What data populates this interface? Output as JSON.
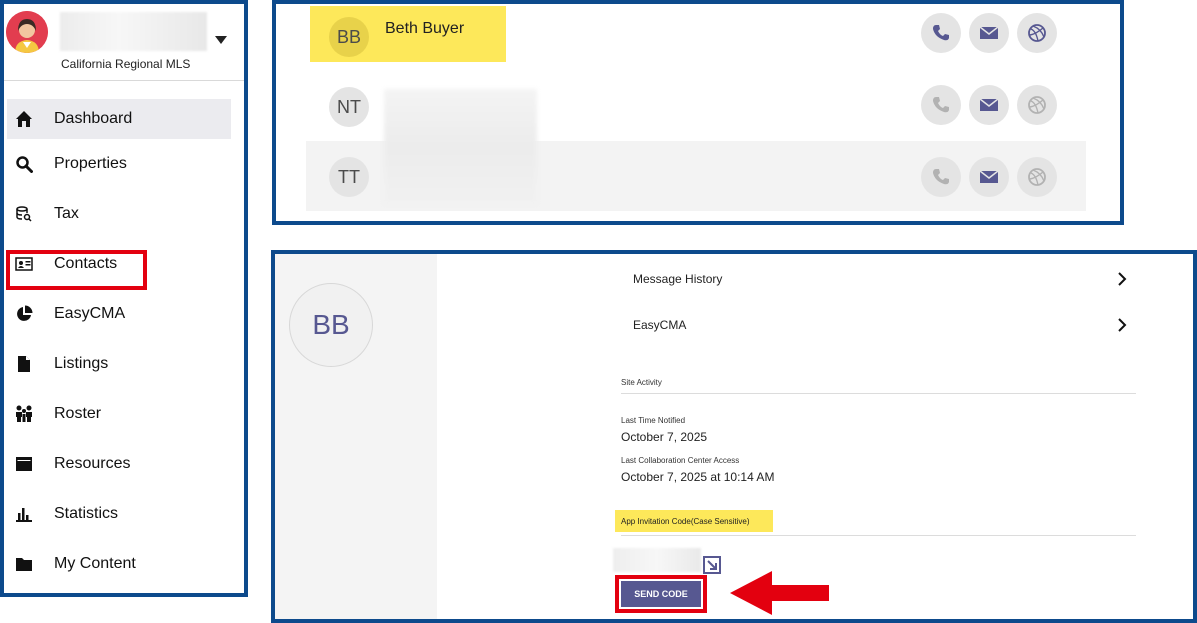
{
  "colors": {
    "frame": "#0d4a8c",
    "highlight_red": "#e3000f",
    "highlight_yellow": "#fde85a",
    "accent_purple": "#575891",
    "active_nav_bg": "#ebebef"
  },
  "profile": {
    "organization": "California Regional MLS",
    "menu_icon": "caret-down-icon"
  },
  "sidebar": {
    "items": [
      {
        "label": "Dashboard",
        "icon": "home-icon"
      },
      {
        "label": "Properties",
        "icon": "search-icon"
      },
      {
        "label": "Tax",
        "icon": "database-search-icon"
      },
      {
        "label": "Contacts",
        "icon": "contact-card-icon"
      },
      {
        "label": "EasyCMA",
        "icon": "pie-chart-icon"
      },
      {
        "label": "Listings",
        "icon": "document-icon"
      },
      {
        "label": "Roster",
        "icon": "people-icon"
      },
      {
        "label": "Resources",
        "icon": "window-icon"
      },
      {
        "label": "Statistics",
        "icon": "bar-chart-icon"
      },
      {
        "label": "My Content",
        "icon": "folder-icon"
      }
    ]
  },
  "contacts": {
    "rows": [
      {
        "initials": "BB",
        "name": "Beth Buyer"
      },
      {
        "initials": "NT",
        "name": ""
      },
      {
        "initials": "TT",
        "name": ""
      }
    ],
    "action_icons": [
      "phone-icon",
      "mail-icon",
      "globe-icon"
    ]
  },
  "detail": {
    "avatar_initials": "BB",
    "menu": [
      {
        "label": "Message History"
      },
      {
        "label": "EasyCMA"
      }
    ],
    "site_activity_label": "Site Activity",
    "last_notified_label": "Last Time Notified",
    "last_notified_value": "October 7, 2025",
    "last_access_label": "Last Collaboration Center Access",
    "last_access_value": "October 7, 2025 at 10:14 AM",
    "invitation_code_label": "App Invitation Code(Case Sensitive)",
    "send_code_label": "SEND CODE"
  }
}
